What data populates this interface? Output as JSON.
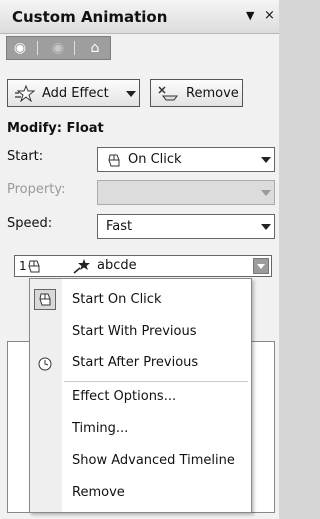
{
  "title": "Custom Animation",
  "title_menu_glyph": "▼",
  "title_close_glyph": "×",
  "nav": {
    "back_glyph": "◉",
    "forward_glyph": "◉",
    "home_glyph": "⌂"
  },
  "buttons": {
    "add_effect": "Add Effect",
    "remove": "Remove"
  },
  "modify_label": "Modify: Float",
  "start": {
    "label": "Start:",
    "value": "On Click"
  },
  "property": {
    "label": "Property:",
    "value": ""
  },
  "speed": {
    "label": "Speed:",
    "value": "Fast"
  },
  "effect_item": {
    "number": "1",
    "name": "abcde"
  },
  "context_menu": [
    "Start On Click",
    "Start With Previous",
    "Start After Previous",
    "Effect Options...",
    "Timing...",
    "Show Advanced Timeline",
    "Remove"
  ]
}
